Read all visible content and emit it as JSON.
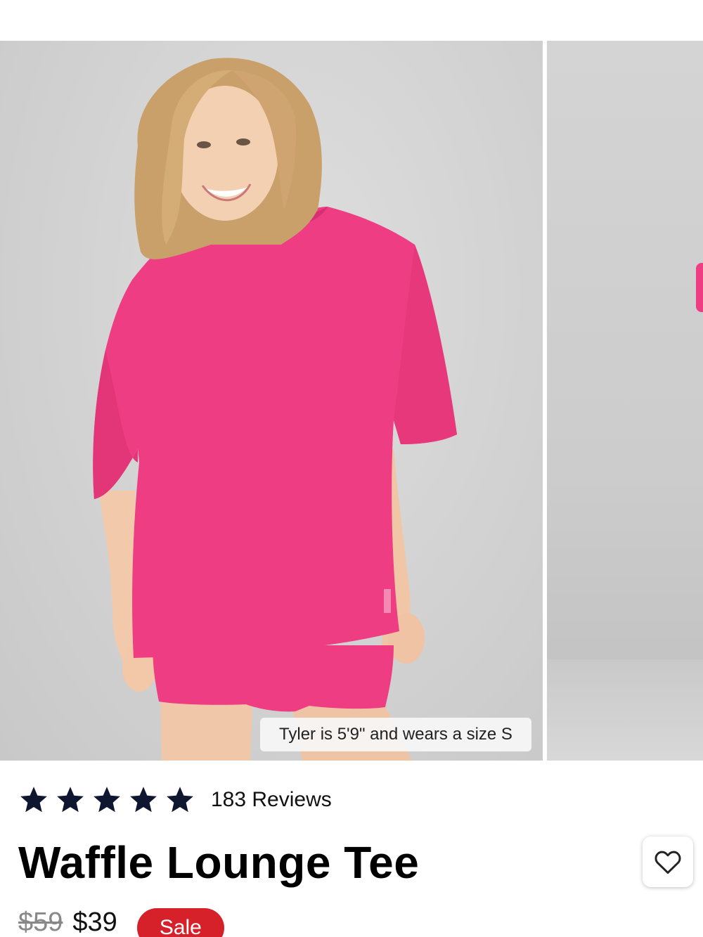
{
  "gallery": {
    "caption": "Tyler is 5'9\" and wears a size S",
    "image_description_icon": "product-photo-pink-waffle-tee"
  },
  "product": {
    "rating": 5,
    "rating_max": 5,
    "reviews_label": "183 Reviews",
    "title": "Waffle Lounge Tee",
    "original_price": "$59",
    "sale_price": "$39",
    "badge": "Sale"
  },
  "colors": {
    "accent_pink": "#ee3d83",
    "sale_red": "#d6202a",
    "star_navy": "#0e1630"
  },
  "icons": {
    "favorite": "heart-outline-icon",
    "star": "star-icon"
  }
}
